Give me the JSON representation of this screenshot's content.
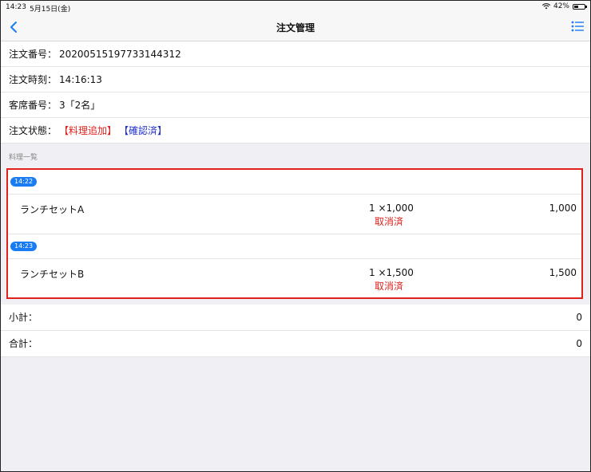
{
  "statusbar": {
    "time": "14:23",
    "date": "5月15日(金)",
    "battery": "42%",
    "battery_level": 0.42
  },
  "nav": {
    "title": "注文管理",
    "back_icon": "chevron-left-icon",
    "menu_icon": "list-icon"
  },
  "order": {
    "number_label": "注文番号：",
    "number": "20200515197733144312",
    "time_label": "注文時刻：",
    "time": "14:16:13",
    "seat_label": "客席番号：",
    "seat": "3「2名」",
    "status_label": "注文状態：",
    "status_added": "【料理追加】",
    "status_confirmed": "【確認済】"
  },
  "section_label": "料理一覧",
  "groups": [
    {
      "time": "14:22",
      "item": {
        "name": "ランチセットA",
        "qty": "1 ×1,000",
        "status": "取消済",
        "price": "1,000"
      }
    },
    {
      "time": "14:23",
      "item": {
        "name": "ランチセットB",
        "qty": "1 ×1,500",
        "status": "取消済",
        "price": "1,500"
      }
    }
  ],
  "totals": {
    "subtotal_label": "小計：",
    "subtotal": "0",
    "total_label": "合計：",
    "total": "0"
  },
  "colors": {
    "accent": "#1a7cf2",
    "danger": "#e0211b",
    "confirm": "#2031c9"
  }
}
